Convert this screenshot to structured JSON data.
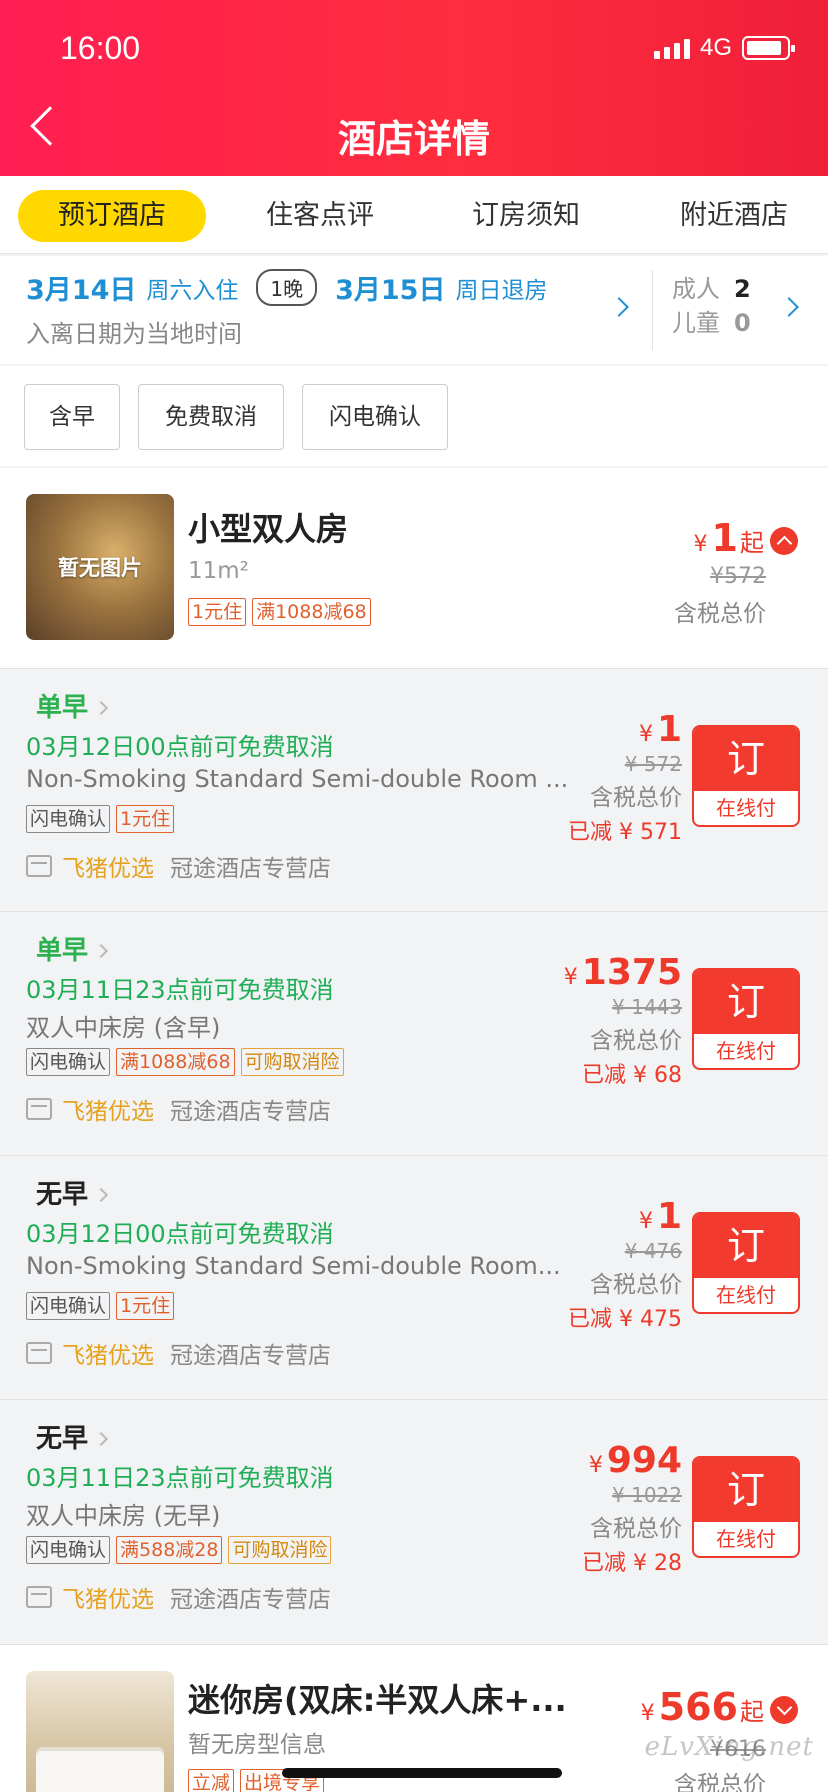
{
  "status_bar": {
    "time": "16:00",
    "network": "4G"
  },
  "header": {
    "title": "酒店详情"
  },
  "tabs": [
    "预订酒店",
    "住客点评",
    "订房须知",
    "附近酒店"
  ],
  "dates": {
    "checkin_date": "3月14日",
    "checkin_label": "周六入住",
    "nights": "1晚",
    "checkout_date": "3月15日",
    "checkout_label": "周日退房",
    "note": "入离日期为当地时间"
  },
  "guests": {
    "adult_label": "成人",
    "adult_count": "2",
    "child_label": "儿童",
    "child_count": "0"
  },
  "filters": [
    "含早",
    "免费取消",
    "闪电确认"
  ],
  "room1": {
    "thumb_text": "暂无图片",
    "title": "小型双人房",
    "size": "11m²",
    "tags": [
      "1元住",
      "满1088减68"
    ],
    "yen": "¥",
    "price": "1",
    "from": "起",
    "orig_price": "¥572",
    "tax_label": "含税总价"
  },
  "rates": [
    {
      "meal": "单早",
      "cancel": "03月12日00点前可免费取消",
      "name": "Non-Smoking Standard Semi-double Room ...",
      "tags": [
        "闪电确认",
        "1元住"
      ],
      "shop_brand": "飞猪优选",
      "shop_name": "冠途酒店专营店",
      "yen": "¥",
      "price": "1",
      "orig": "¥ 572",
      "tax": "含税总价",
      "saved": "已减 ¥ 571",
      "book": "订",
      "pay": "在线付"
    },
    {
      "meal": "单早",
      "cancel": "03月11日23点前可免费取消",
      "name": "双人中床房 (含早)",
      "tags": [
        "闪电确认",
        "满1088减68",
        "可购取消险"
      ],
      "shop_brand": "飞猪优选",
      "shop_name": "冠途酒店专营店",
      "yen": "¥",
      "price": "1375",
      "orig": "¥ 1443",
      "tax": "含税总价",
      "saved": "已减 ¥ 68",
      "book": "订",
      "pay": "在线付"
    },
    {
      "meal": "无早",
      "cancel": "03月12日00点前可免费取消",
      "name": "Non-Smoking Standard Semi-double Room...",
      "tags": [
        "闪电确认",
        "1元住"
      ],
      "shop_brand": "飞猪优选",
      "shop_name": "冠途酒店专营店",
      "yen": "¥",
      "price": "1",
      "orig": "¥ 476",
      "tax": "含税总价",
      "saved": "已减 ¥ 475",
      "book": "订",
      "pay": "在线付"
    },
    {
      "meal": "无早",
      "cancel": "03月11日23点前可免费取消",
      "name": "双人中床房 (无早)",
      "tags": [
        "闪电确认",
        "满588减28",
        "可购取消险"
      ],
      "shop_brand": "飞猪优选",
      "shop_name": "冠途酒店专营店",
      "yen": "¥",
      "price": "994",
      "orig": "¥ 1022",
      "tax": "含税总价",
      "saved": "已减 ¥ 28",
      "book": "订",
      "pay": "在线付"
    }
  ],
  "room2": {
    "title": "迷你房(双床:半双人床+...",
    "info": "暂无房型信息",
    "tags": [
      "立减",
      "出境专享"
    ],
    "yen": "¥",
    "price": "566",
    "from": "起",
    "orig_price": "¥616",
    "tax_label": "含税总价"
  },
  "watermark": "eLvXing.net",
  "colors": {
    "brand_red": "#ff1e52",
    "price_red": "#ee3a2a",
    "tab_yellow": "#ffd800",
    "cancel_green": "#1fae55",
    "date_blue": "#1f8fd4"
  }
}
